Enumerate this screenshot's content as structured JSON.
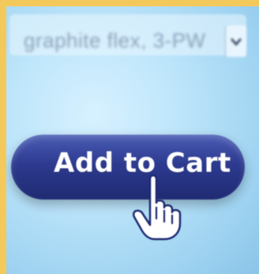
{
  "product": {
    "variant_field_text": "graphite flex, 3-PW"
  },
  "actions": {
    "add_to_cart_label": "Add to Cart"
  },
  "icons": {
    "dropdown": "chevron-down-icon",
    "cursor": "hand-pointer-icon"
  },
  "colors": {
    "button_primary": "#2d3a8f",
    "screen_background": "#bfe6fb",
    "border": "#f4c95b"
  }
}
